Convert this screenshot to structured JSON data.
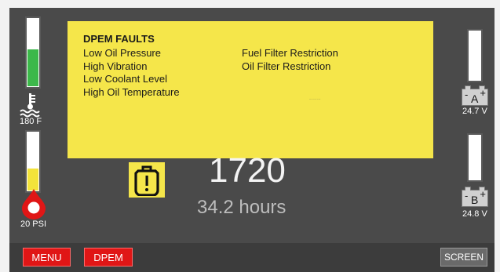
{
  "coolant": {
    "value_label": "180 F",
    "fill_fraction": 0.55,
    "fill_color": "#3cb84a",
    "icon": "coolant-temperature-icon"
  },
  "oil_pressure": {
    "value_label": "20 PSI",
    "fill_fraction": 0.38,
    "fill_color": "#f3e33a",
    "icon": "oil-drop-icon"
  },
  "fault_panel": {
    "title": "DPEM FAULTS",
    "left_faults": [
      "Low Oil Pressure",
      "High Vibration",
      "Low Coolant Level",
      "High Oil Temperature"
    ],
    "right_faults": [
      "Fuel Filter Restriction",
      "Oil Filter Restriction"
    ],
    "faint_text": "······",
    "background": "#f5e64a"
  },
  "engine": {
    "rpm": "1720",
    "hours": "34.2 hours",
    "icon": "engine-warning-icon"
  },
  "battery_a": {
    "letter": "A",
    "minus": "-",
    "plus": "+",
    "voltage": "24.7 V",
    "fill_fraction": 0.0
  },
  "battery_b": {
    "letter": "B",
    "minus": "-",
    "plus": "+",
    "voltage": "24.8 V",
    "fill_fraction": 0.0
  },
  "buttons": {
    "menu": "MENU",
    "dpem": "DPEM",
    "screen": "SCREEN"
  },
  "colors": {
    "button_red": "#e01616",
    "screen_bg": "#4a4a4a",
    "accent_yellow": "#f5e64a"
  }
}
